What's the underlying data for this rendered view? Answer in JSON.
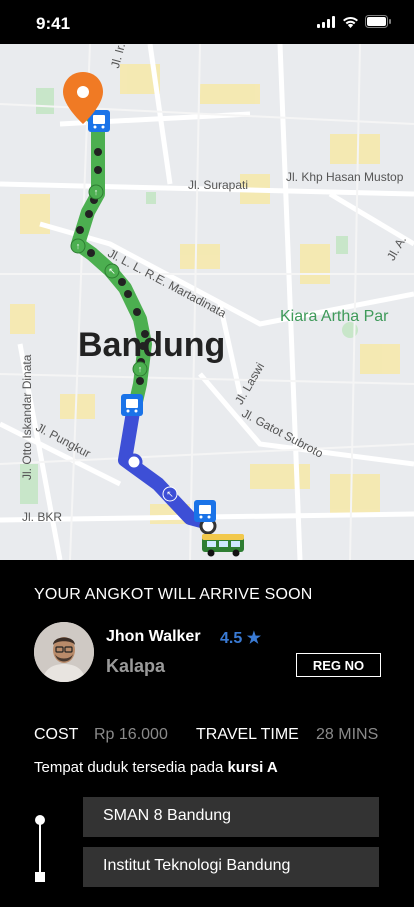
{
  "status_bar": {
    "time": "9:41",
    "icons": [
      "signal-icon",
      "wifi-icon",
      "battery-icon"
    ]
  },
  "map": {
    "city": "Bandung",
    "park": "Kiara Artha Par",
    "streets": [
      "Jl. Ir. H.",
      "Jl. Surapati",
      "Jl. Khp Hasan Mustop",
      "Jl. A.",
      "Jl. L. L. R.E. Martadinata",
      "Jl. Otto Iskandar Dinata",
      "Jl. Laswi",
      "Jl. Gatot Subroto",
      "Jl. Pungkur",
      "Jl. BKR"
    ],
    "colors": {
      "walk_route": "#4caf50",
      "bus_route": "#3d4fd6",
      "destination_pin": "#f07a24",
      "stop_marker": "#1a73e8"
    }
  },
  "panel": {
    "title": "YOUR ANGKOT WILL ARRIVE SOON",
    "driver": {
      "name": "Jhon Walker",
      "rating": "4.5 ★",
      "route": "Kalapa"
    },
    "reg_button": "REG NO",
    "cost": {
      "label": "COST",
      "value": "Rp 16.000"
    },
    "travel_time": {
      "label": "TRAVEL TIME",
      "value": "28 MINS"
    },
    "seat": {
      "prefix": "Tempat duduk tersedia pada ",
      "seat": "kursi A"
    },
    "route": {
      "from": "SMAN 8 Bandung",
      "to": "Institut Teknologi Bandung"
    }
  }
}
